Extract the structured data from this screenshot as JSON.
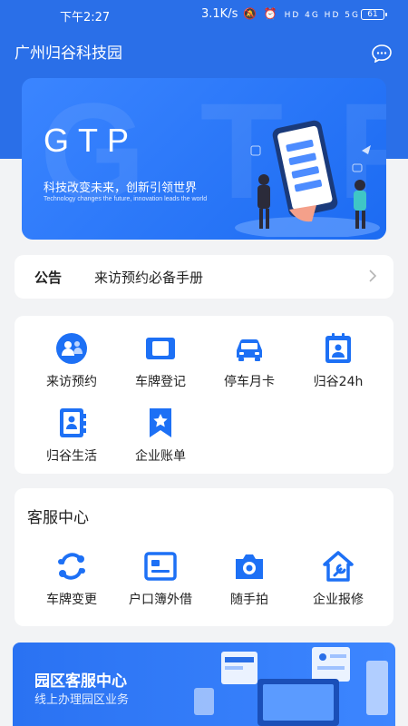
{
  "status_bar": {
    "time": "下午2:27",
    "speed": "3.1K/s",
    "network_labels": "HD 4G HD 5G",
    "battery": "61"
  },
  "header": {
    "title": "广州归谷科技园"
  },
  "banner": {
    "brand": "GTP",
    "slogan_cn": "科技改变未来，创新引领世界",
    "slogan_en": "Technology changes the future, innovation leads the world"
  },
  "notice": {
    "label": "公告",
    "text": "来访预约必备手册"
  },
  "services": [
    {
      "label": "来访预约",
      "icon": "visitor-icon"
    },
    {
      "label": "车牌登记",
      "icon": "plate-icon"
    },
    {
      "label": "停车月卡",
      "icon": "car-icon"
    },
    {
      "label": "归谷24h",
      "icon": "calendar-badge-icon"
    },
    {
      "label": "归谷生活",
      "icon": "contacts-book-icon"
    },
    {
      "label": "企业账单",
      "icon": "bookmark-star-icon"
    }
  ],
  "customer_service": {
    "heading": "客服中心",
    "items": [
      {
        "label": "车牌变更",
        "icon": "exchange-icon"
      },
      {
        "label": "户口簿外借",
        "icon": "id-card-icon"
      },
      {
        "label": "随手拍",
        "icon": "camera-icon"
      },
      {
        "label": "企业报修",
        "icon": "house-repair-icon"
      }
    ]
  },
  "promo": {
    "title": "园区客服中心",
    "subtitle": "线上办理园区业务"
  },
  "colors": {
    "primary": "#2a6fe8",
    "accent": "#1d70f5",
    "background": "#f2f3f5"
  }
}
